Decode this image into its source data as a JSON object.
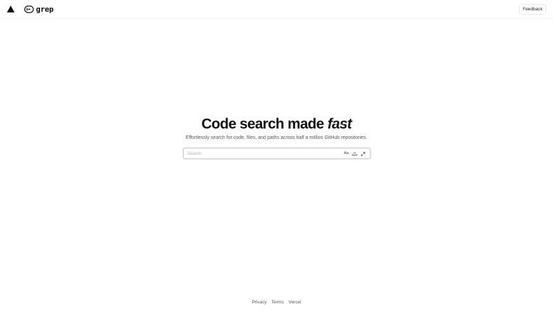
{
  "header": {
    "logo_icon": "vercel-triangle-icon",
    "brand_icon": "grep-logo-icon",
    "brand_name": "grep",
    "feedback_label": "Feedback"
  },
  "hero": {
    "title_prefix": "Code search made ",
    "title_accent": "fast",
    "subtitle": "Effortlessly search for code, files, and paths across half a million GitHub repositories."
  },
  "search": {
    "value": "",
    "placeholder": "Search",
    "options": [
      {
        "label": "Aa",
        "icon": "match-case-icon"
      },
      {
        "label": "",
        "icon": "match-whole-words-icon"
      },
      {
        "label": "",
        "icon": "regex-icon"
      }
    ]
  },
  "footer": {
    "links": [
      {
        "label": "Privacy"
      },
      {
        "label": "Terms"
      },
      {
        "label": "Vercel"
      }
    ]
  },
  "colors": {
    "text": "#171717",
    "muted": "#555555",
    "border": "#cfcfcf",
    "background": "#ffffff"
  }
}
